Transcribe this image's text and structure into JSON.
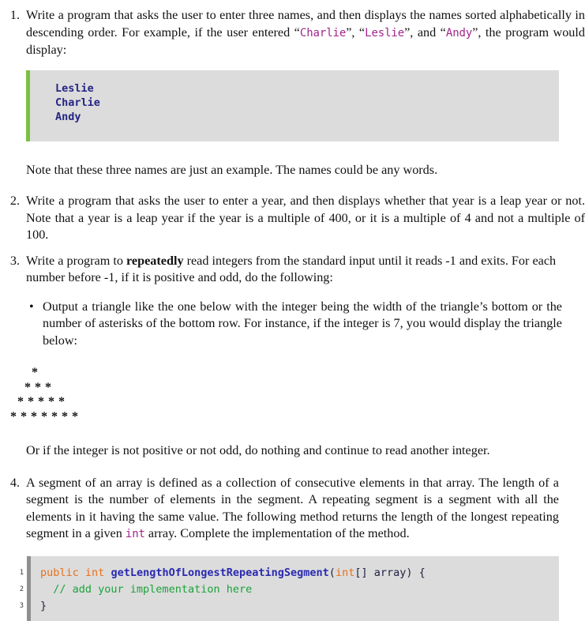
{
  "document": {
    "questions": [
      {
        "number": "1.",
        "text_parts": [
          {
            "t": "Write a program that asks the user to enter three names, and then displays the names sorted alphabetically in descending order. For example, if the user entered “",
            "k": "plain"
          },
          {
            "t": "Charlie",
            "k": "code"
          },
          {
            "t": "”, “",
            "k": "plain"
          },
          {
            "t": "Leslie",
            "k": "code"
          },
          {
            "t": "”, and “",
            "k": "plain"
          },
          {
            "t": "Andy",
            "k": "code"
          },
          {
            "t": "”, the program would display:",
            "k": "plain"
          }
        ]
      },
      {
        "number": "2.",
        "text_parts": [
          {
            "t": "Write a program that asks the user to enter a year, and then displays whether that year is a leap year or not. Note that a year is a leap year if the year is a multiple of 400, or it is a multiple of 4 and not a multiple of 100.",
            "k": "plain"
          }
        ]
      },
      {
        "number": "3.",
        "text_parts": [
          {
            "t": "Write a program to ",
            "k": "plain"
          },
          {
            "t": "repeatedly",
            "k": "bold"
          },
          {
            "t": " read integers from the standard input until it reads -1 and exits. For each number before -1, if it is positive and odd, do the following:",
            "k": "plain"
          }
        ]
      },
      {
        "number": "4.",
        "text_parts": [
          {
            "t": "A segment of an array is defined as a collection of consecutive elements in that array. The length of a segment is the number of elements in the segment.  A repeating segment is a segment with all the elements in it having the same value.  The following method returns the length of the longest repeating segment in a given ",
            "k": "plain"
          },
          {
            "t": "int",
            "k": "code"
          },
          {
            "t": " array.  Complete the implementation of the method.",
            "k": "plain"
          }
        ]
      }
    ],
    "output_block": {
      "lines": [
        "Leslie",
        "Charlie",
        "Andy"
      ],
      "text": "Leslie\nCharlie\nAndy",
      "accent_color": "#7cc043",
      "background_color": "#dcdcdc",
      "text_color": "#252585"
    },
    "note_after_q1": "Note that these three names are just an example. The names could be any words.",
    "bullet_q3": {
      "marker": "•",
      "text": "Output a triangle like the one below with the integer being the width of the triangle’s bottom or the number of asterisks of the bottom row.  For instance, if the integer is 7, you would display the triangle below:"
    },
    "triangle": {
      "rows": [
        "      *",
        "    * * *",
        "  * * * * *",
        "* * * * * * *"
      ],
      "text": "      *\n    * * *\n  * * * * *\n* * * * * * *"
    },
    "note_after_triangle": "Or if the integer is not positive or not odd, do nothing and continue to read another integer.",
    "java_block": {
      "line_numbers": [
        "1",
        "2",
        "3"
      ],
      "gutter_bar_color": "#8f8f8f",
      "background_color": "#dcdcdc",
      "line1": {
        "kw1": "public",
        "space1": " ",
        "kw2": "int",
        "space2": " ",
        "fn": "getLengthOfLongestRepeatingSegment",
        "paren_open": "(",
        "kw3": "int",
        "rest": "[] array) {"
      },
      "line2": {
        "indent": "  ",
        "comment": "// add your implementation here"
      },
      "line3": {
        "brace": "}"
      }
    },
    "colors": {
      "keyword": "#e8701a",
      "function": "#2a2ab0",
      "comment": "#1aa33a",
      "inline_code": "#a0258a",
      "body_text": "#111111"
    }
  }
}
